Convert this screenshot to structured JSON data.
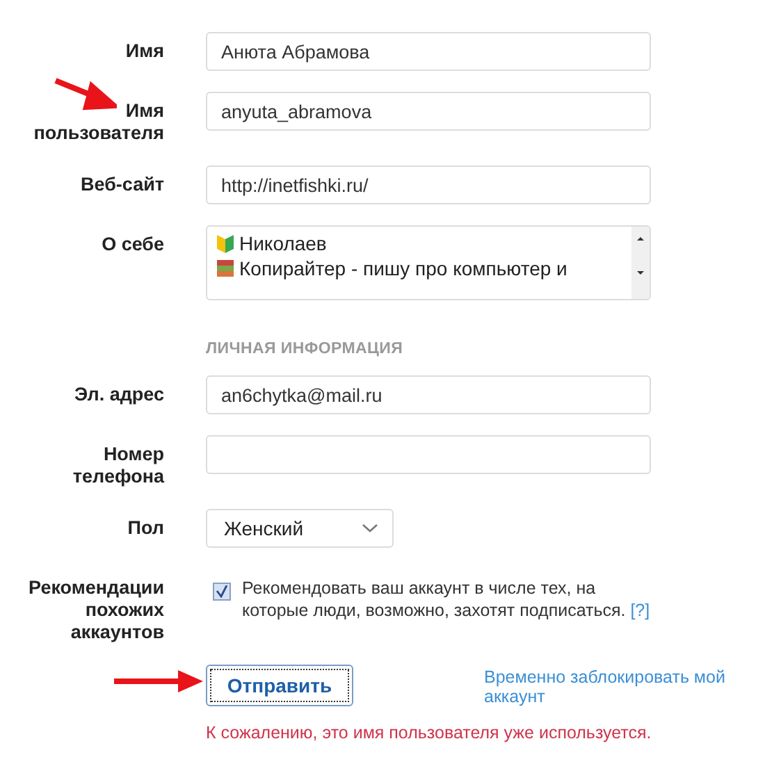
{
  "rows": [
    {
      "kind": "text",
      "label": "Имя",
      "value": "Анюта Абрамова"
    },
    {
      "kind": "text",
      "label": "Имя пользователя",
      "value": "anyuta_abramova",
      "arrow": true
    },
    {
      "kind": "text",
      "label": "Веб-сайт",
      "value": "http://inetfishki.ru/"
    },
    {
      "kind": "textarea",
      "label": "О себе",
      "lines": [
        "Николаев",
        "Копирайтер - пишу про компьютер и"
      ]
    },
    {
      "kind": "heading",
      "label": "ЛИЧНАЯ ИНФОРМАЦИЯ"
    },
    {
      "kind": "text",
      "label": "Эл. адрес",
      "value": "an6chytka@mail.ru"
    },
    {
      "kind": "text",
      "label": "Номер телефона",
      "value": ""
    },
    {
      "kind": "select",
      "label": "Пол",
      "value": "Женский"
    },
    {
      "kind": "checkbox",
      "label": "Рекомендации похожих аккаунтов",
      "checked": true,
      "text": "Рекомендовать ваш аккаунт в числе тех, на которые люди, возможно, захотят подписаться.",
      "help": "[?]"
    }
  ],
  "submit": {
    "label": "Отправить",
    "arrow": true
  },
  "disable_link": "Временно заблокировать мой аккаунт",
  "error": "К сожалению, это имя пользователя уже используется."
}
